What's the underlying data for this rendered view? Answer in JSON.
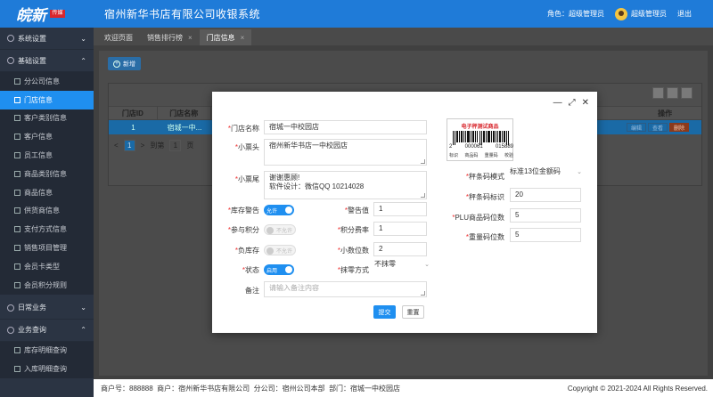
{
  "header": {
    "logo_text": "皖新",
    "logo_badge": "传媒",
    "title": "宿州新华书店有限公司收银系统",
    "role_label": "角色：超级管理员",
    "user_name": "超级管理员",
    "logout": "退出"
  },
  "sidebar": {
    "groups": [
      {
        "label": "系统设置",
        "arrow": "⌄"
      },
      {
        "label": "基础设置",
        "arrow": "⌃"
      }
    ],
    "items": [
      {
        "label": "分公司信息"
      },
      {
        "label": "门店信息"
      },
      {
        "label": "客户类别信息"
      },
      {
        "label": "客户信息"
      },
      {
        "label": "员工信息"
      },
      {
        "label": "商品类别信息"
      },
      {
        "label": "商品信息"
      },
      {
        "label": "供货商信息"
      },
      {
        "label": "支付方式信息"
      },
      {
        "label": "销售项目管理"
      },
      {
        "label": "会员卡类型"
      },
      {
        "label": "会员积分规则"
      }
    ],
    "groups_bottom": [
      {
        "label": "日常业务",
        "arrow": "⌄"
      },
      {
        "label": "业务查询",
        "arrow": "⌃"
      }
    ],
    "items_bottom": [
      {
        "label": "库存明细查询"
      },
      {
        "label": "入库明细查询"
      }
    ]
  },
  "tabs": [
    {
      "label": "欢迎页面",
      "close": ""
    },
    {
      "label": "销售排行榜",
      "close": "×"
    },
    {
      "label": "门店信息",
      "close": "×"
    }
  ],
  "toolbar": {
    "add_label": "新增",
    "add_icon": "+"
  },
  "table": {
    "headers": [
      "门店ID",
      "门店名称",
      "操作"
    ],
    "row": {
      "id": "1",
      "name": "宿城一中...",
      "edit": "编辑",
      "view": "查看",
      "delete": "删除"
    }
  },
  "pager": {
    "prev": "<",
    "current": "1",
    "next": ">",
    "goto": "到第",
    "page_input": "1",
    "page_unit": "页"
  },
  "footer": {
    "merchant_no": "商户号：888888",
    "merchant": "商户：宿州新华书店有限公司",
    "branch": "分公司：宿州公司本部",
    "department": "部门：宿城一中校园店",
    "copyright": "Copyright © 2021-2024 All Rights Reserved."
  },
  "modal": {
    "store_name_label": "门店名称",
    "store_name": "宿城一中校园店",
    "header_label": "小票头",
    "header_text": "宿州新华书店一中校园店",
    "footer_label": "小票尾",
    "footer_line1": "谢谢惠顾!",
    "footer_line2": "软件设计：微信QQ 10214028",
    "stock_alert_label": "库存警告",
    "stock_alert_state": "允许",
    "alert_value_label": "警告值",
    "alert_value": "1",
    "points_label": "参与积分",
    "points_state": "不允许",
    "points_rate_label": "积分费率",
    "points_rate": "1",
    "neg_stock_label": "负库存",
    "neg_stock_state": "不允许",
    "decimal_label": "小数位数",
    "decimal_value": "2",
    "status_label": "状态",
    "status_state": "启用",
    "rounding_label": "抹零方式",
    "rounding_value": "不抹零",
    "remark_label": "备注",
    "remark_placeholder": "请输入备注内容",
    "scale_mode_label": "秤条码模式",
    "scale_mode_value": "标准13位金额码",
    "scale_flag_label": "秤条码标识",
    "scale_flag_value": "20",
    "plu_digits_label": "PLU商品码位数",
    "plu_digits_value": "5",
    "weight_digits_label": "重量码位数",
    "weight_digits_value": "5",
    "submit": "提交",
    "reset": "重置",
    "barcode": {
      "title": "电子秤测试商品",
      "n1": "2",
      "n2": "000061",
      "n3": "015889",
      "cap1": "标识",
      "cap2": "商品码",
      "cap3": "重量码",
      "cap4": "校验"
    }
  }
}
